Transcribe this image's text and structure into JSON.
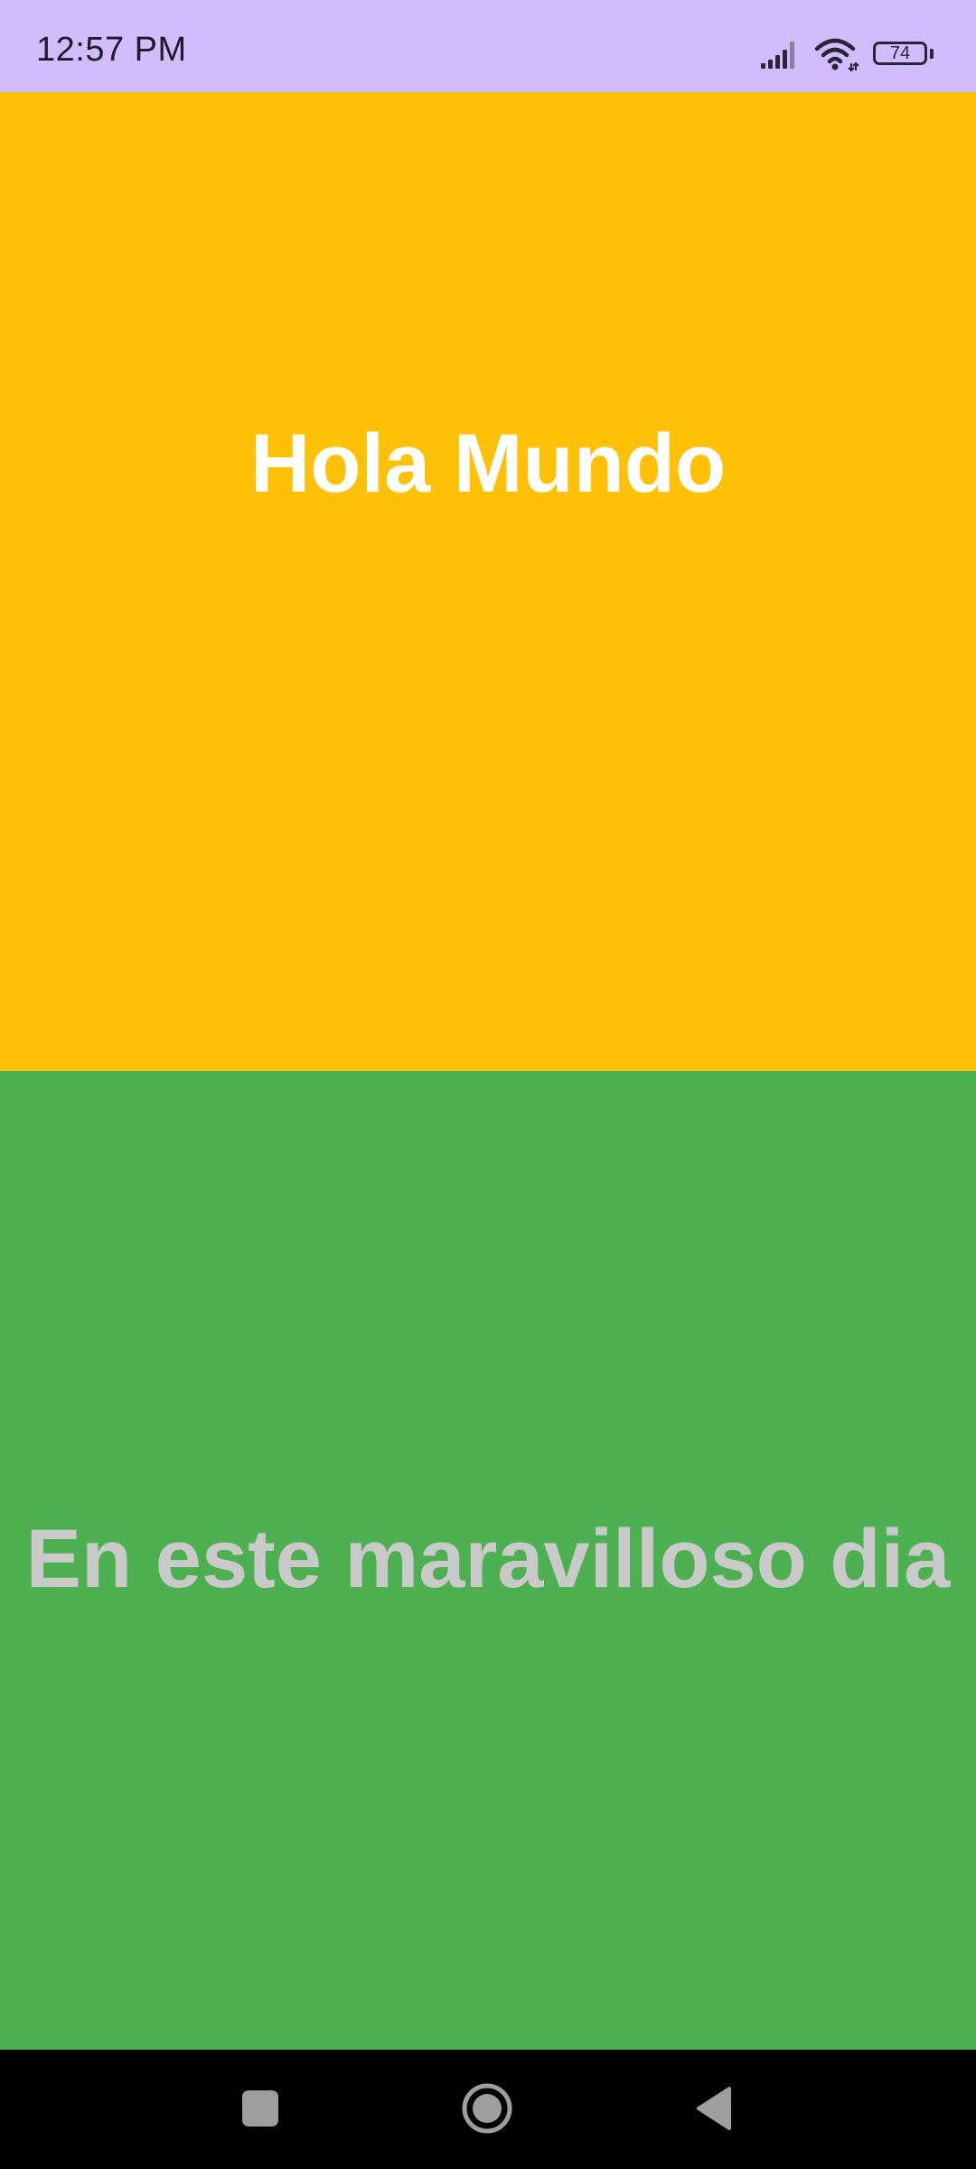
{
  "status_bar": {
    "time": "12:57 PM",
    "battery_level": "74",
    "background_color": "#d1bdfd",
    "icons": [
      "signal-icon",
      "wifi-icon",
      "battery-icon"
    ]
  },
  "top_panel": {
    "text": "Hola Mundo",
    "background_color": "#ffc107",
    "text_color": "#ffffff"
  },
  "bottom_panel": {
    "text": "En este maravilloso dia",
    "background_color": "#4caf50",
    "text_color": "#c9c9c9"
  },
  "nav_bar": {
    "buttons": [
      "recents-icon",
      "home-icon",
      "back-icon"
    ],
    "background_color": "#000000"
  }
}
